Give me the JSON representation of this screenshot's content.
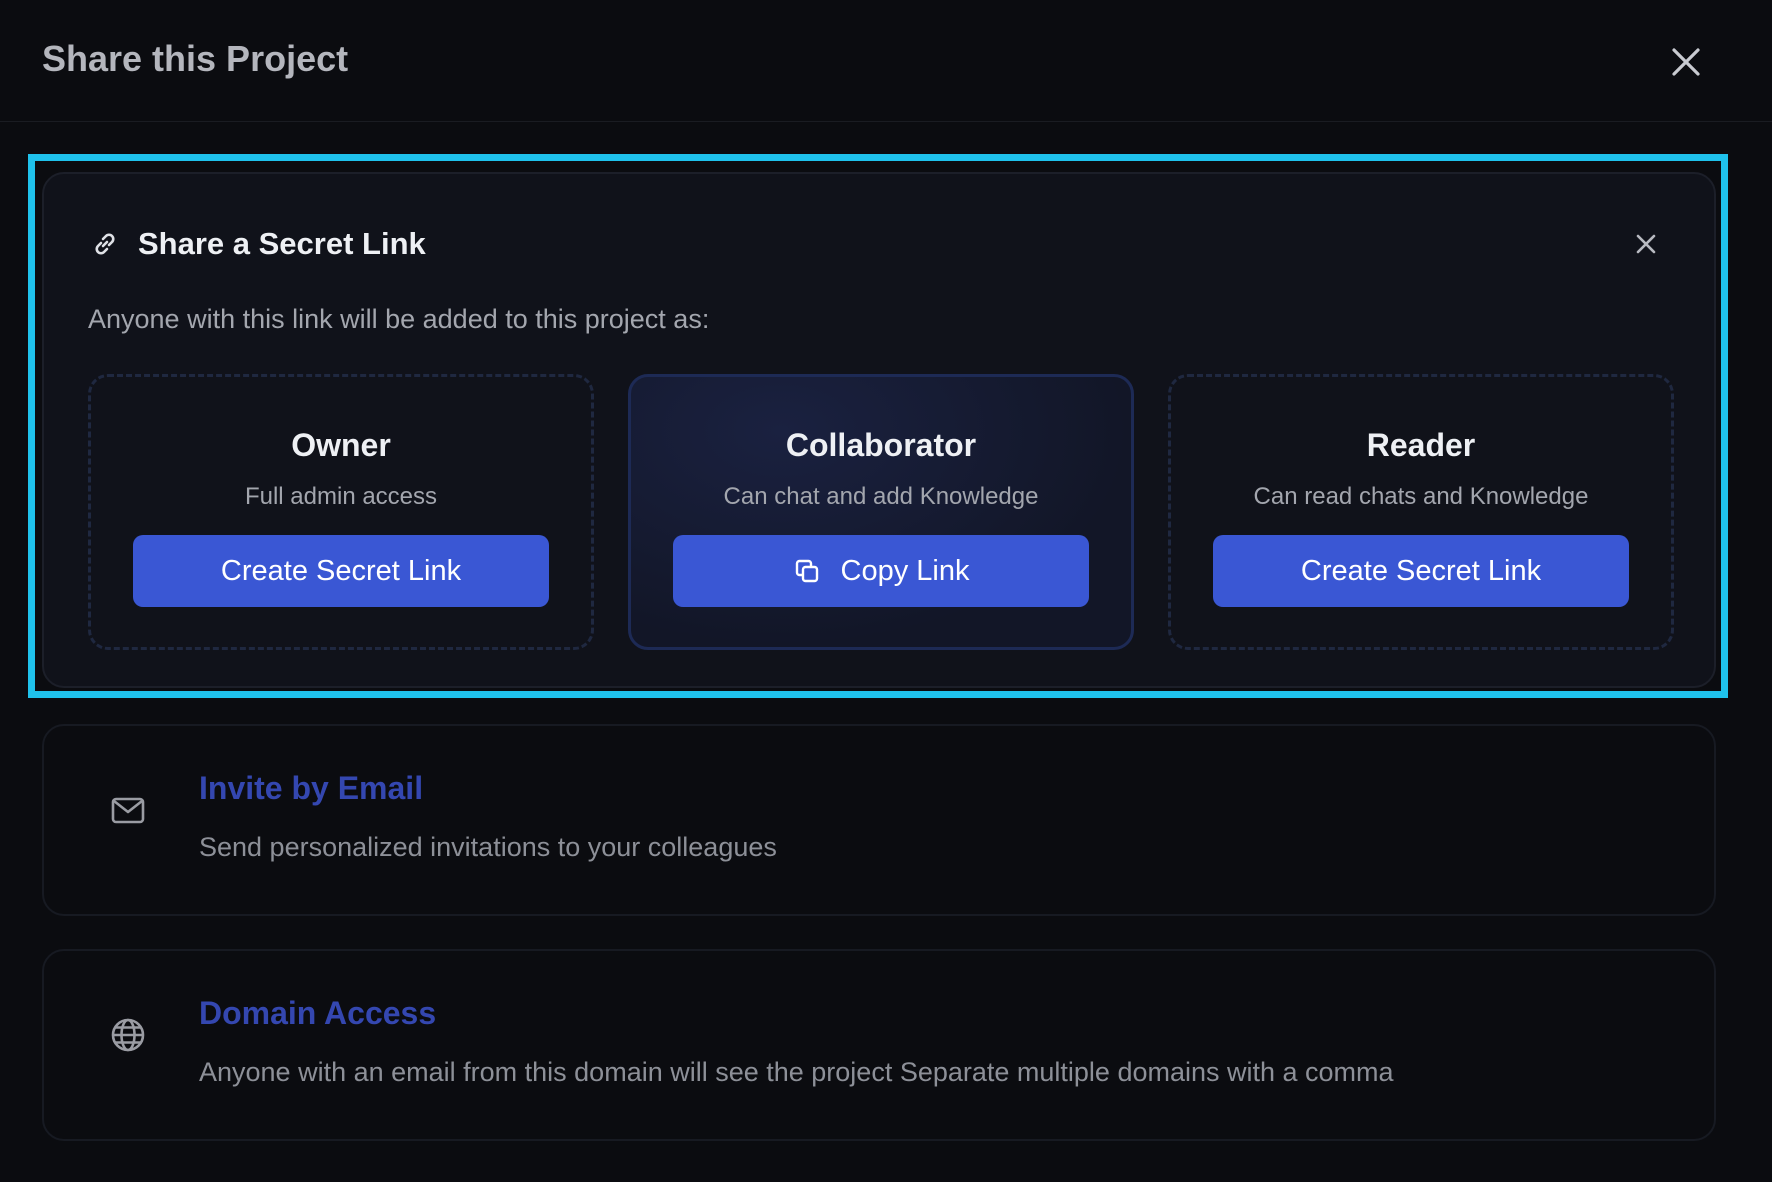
{
  "header": {
    "title": "Share this Project",
    "close_icon": "close-icon"
  },
  "secret_link": {
    "title": "Share a Secret Link",
    "icon": "link-icon",
    "description": "Anyone with this link will be added to this project as:",
    "roles": [
      {
        "name": "Owner",
        "description": "Full admin access",
        "button_label": "Create Secret Link",
        "active": false
      },
      {
        "name": "Collaborator",
        "description": "Can chat and add Knowledge",
        "button_label": "Copy Link",
        "button_icon": "copy-icon",
        "active": true
      },
      {
        "name": "Reader",
        "description": "Can read chats and Knowledge",
        "button_label": "Create Secret Link",
        "active": false
      }
    ]
  },
  "invite_email": {
    "title": "Invite by Email",
    "description": "Send personalized invitations to your colleagues",
    "icon": "mail-icon"
  },
  "domain_access": {
    "title": "Domain Access",
    "description": "Anyone with an email from this domain will see the project Separate multiple domains with a comma",
    "icon": "globe-icon"
  },
  "colors": {
    "background": "#0b0c10",
    "accent": "#3a57d4",
    "highlight": "#1fc2ec",
    "option_title": "#3447b0"
  }
}
